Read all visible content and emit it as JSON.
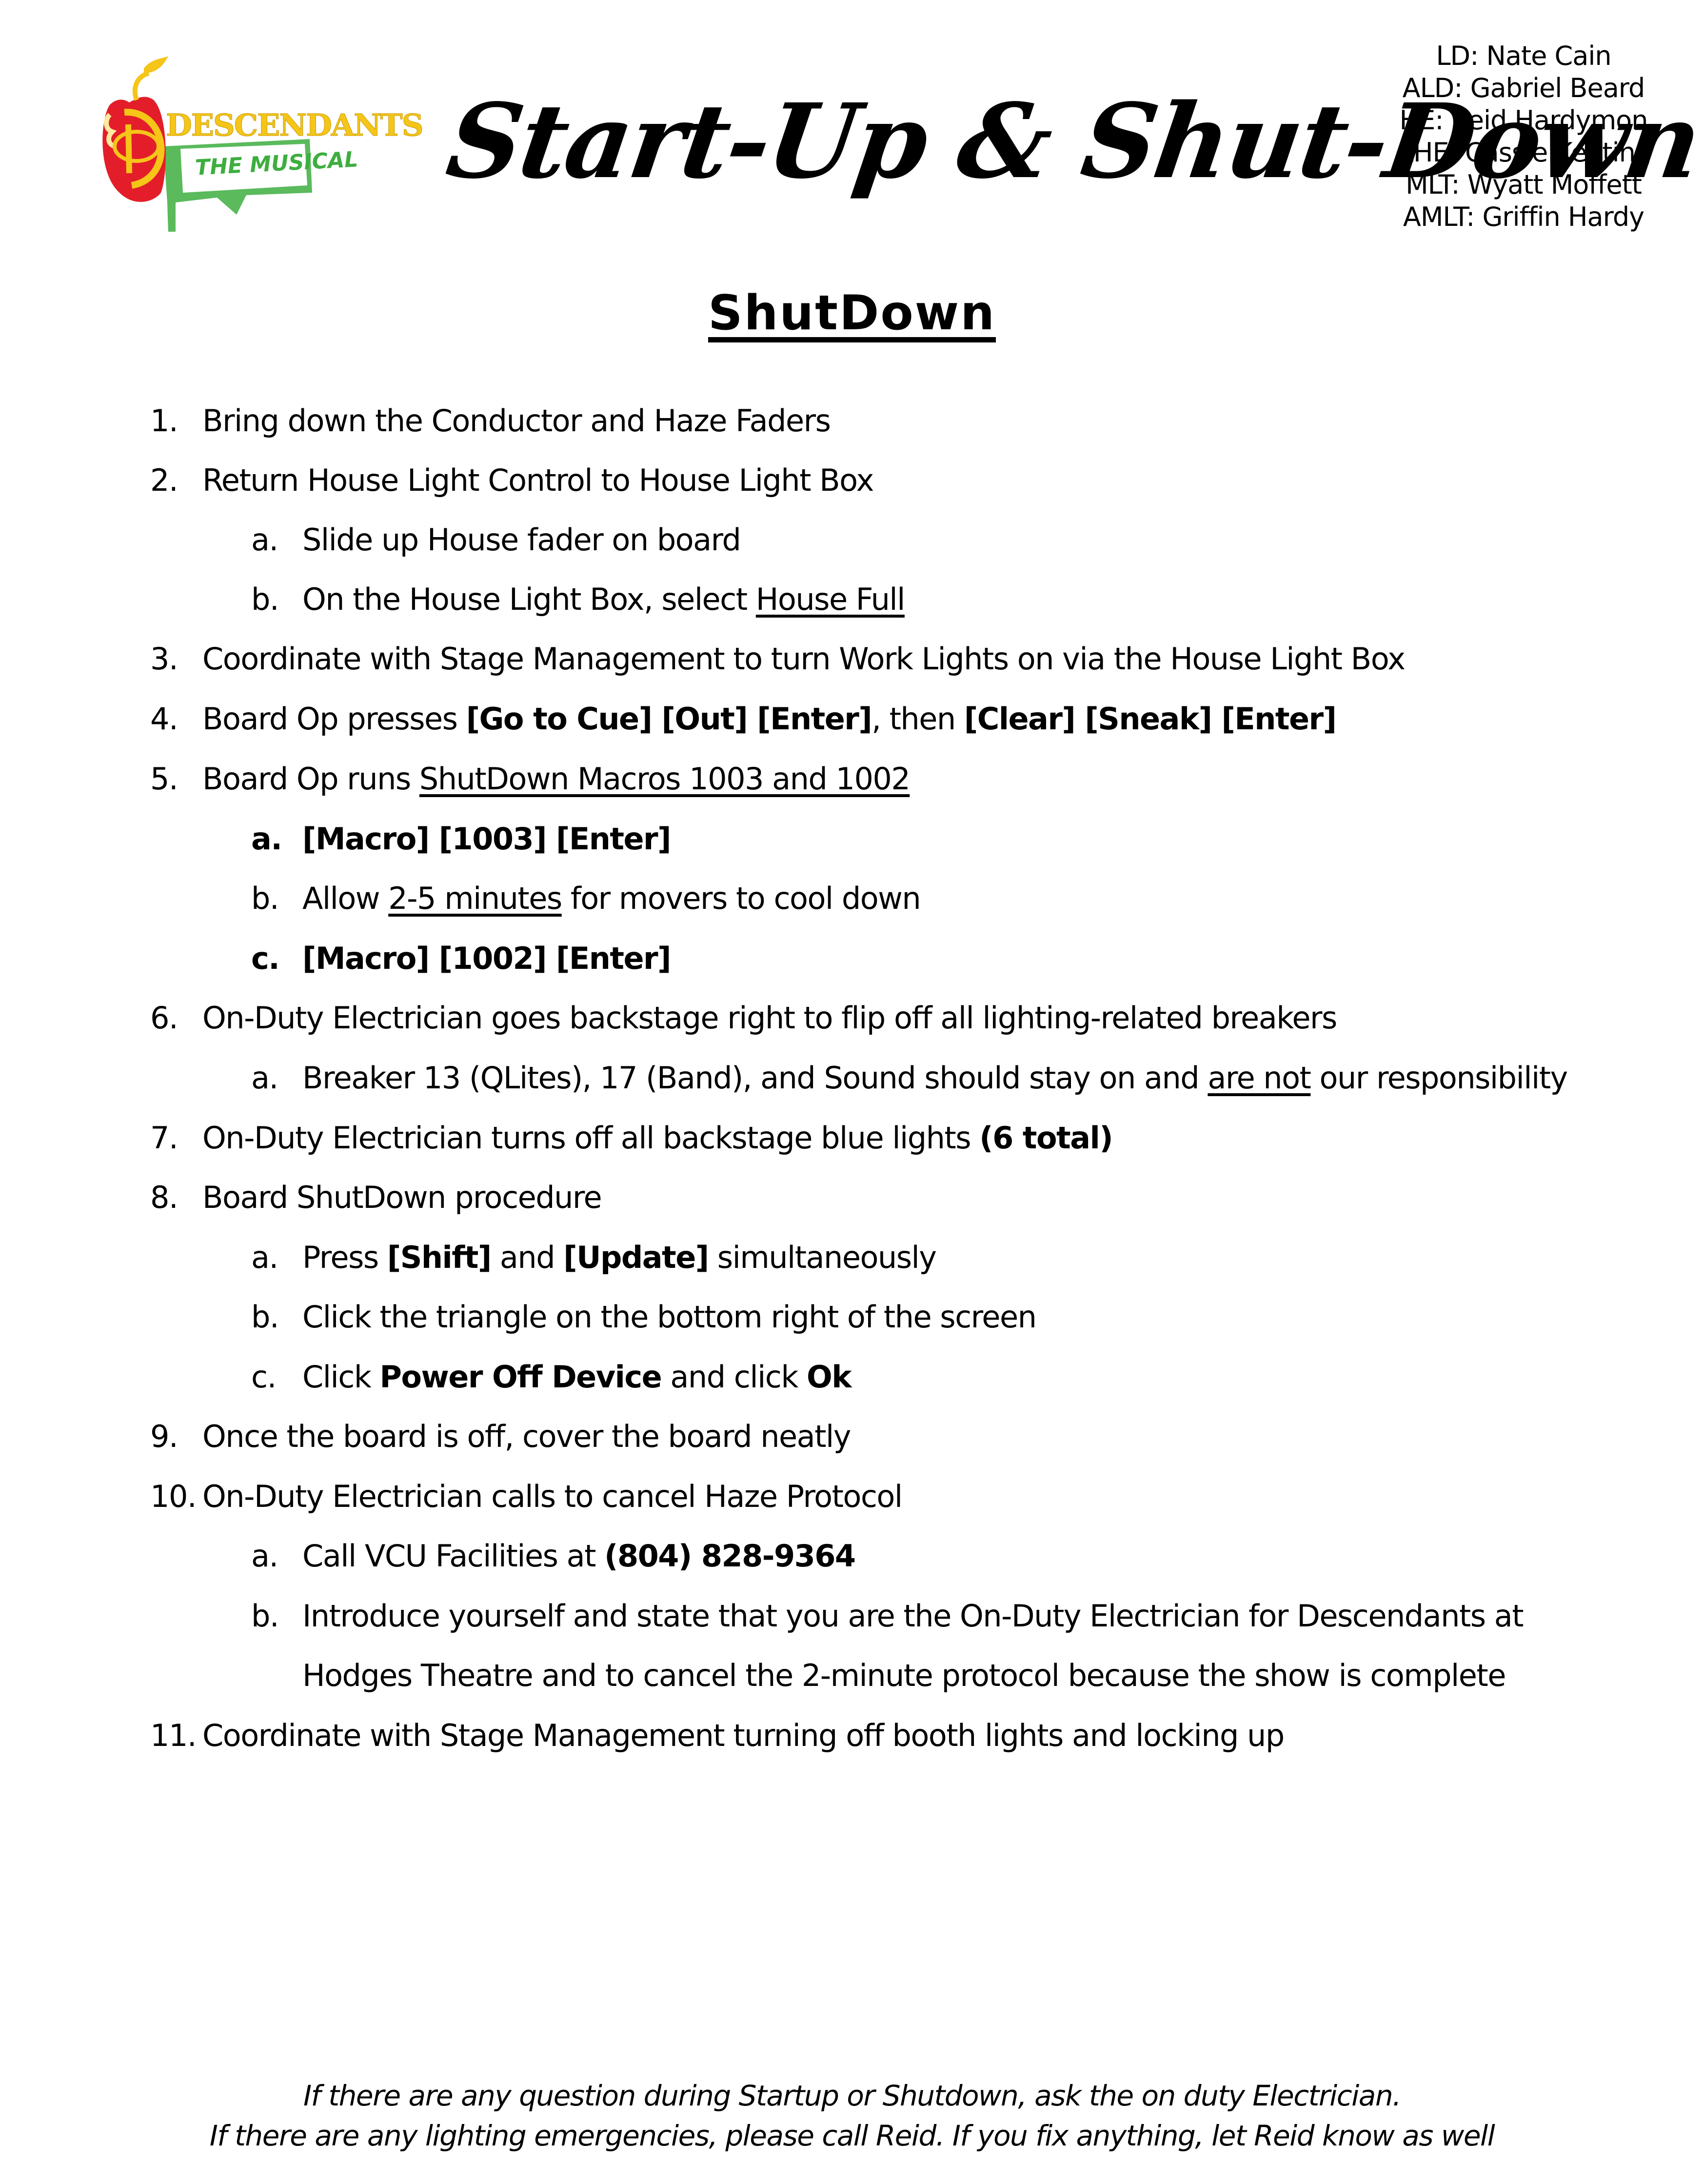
{
  "header": {
    "logo": {
      "name": "descendants-the-musical-logo",
      "wordmark": "DESCENDANTS",
      "tagline": "THE MUSICAL",
      "colors": {
        "apple_red": "#e31e2a",
        "gold": "#f5c518",
        "green": "#3dae3f"
      }
    },
    "title": "Start-Up & Shut-Down",
    "crew": [
      "LD: Nate Cain",
      "ALD: Gabriel Beard",
      "HE: Reid Hardymon",
      "AHE: Cassie Keating",
      "MLT: Wyatt Moffett",
      "AMLT: Griffin Hardy"
    ]
  },
  "section_heading": "ShutDown",
  "steps": [
    {
      "num": "1.",
      "parts": [
        {
          "t": "Bring down the Conductor and Haze Faders"
        }
      ]
    },
    {
      "num": "2.",
      "parts": [
        {
          "t": "Return House Light Control to House Light Box"
        }
      ],
      "subs": [
        {
          "num": "a.",
          "parts": [
            {
              "t": "Slide up House fader on board"
            }
          ]
        },
        {
          "num": "b.",
          "parts": [
            {
              "t": "On the House Light Box, select "
            },
            {
              "t": "House Full",
              "u": true
            }
          ]
        }
      ]
    },
    {
      "num": "3.",
      "parts": [
        {
          "t": "Coordinate with Stage Management to turn Work Lights on via the House Light Box"
        }
      ]
    },
    {
      "num": "4.",
      "parts": [
        {
          "t": "Board Op presses "
        },
        {
          "t": "[Go to Cue] [Out] [Enter]",
          "b": true
        },
        {
          "t": ", then "
        },
        {
          "t": "[Clear] [Sneak] [Enter]",
          "b": true
        }
      ]
    },
    {
      "num": "5.",
      "parts": [
        {
          "t": "Board Op runs "
        },
        {
          "t": "ShutDown Macros 1003 and 1002",
          "u": true
        }
      ],
      "subs": [
        {
          "num": "a.",
          "bold_num": true,
          "parts": [
            {
              "t": "[Macro] [1003] [Enter]",
              "b": true
            }
          ]
        },
        {
          "num": "b.",
          "parts": [
            {
              "t": "Allow "
            },
            {
              "t": "2-5 minutes",
              "u": true
            },
            {
              "t": " for movers to cool down"
            }
          ]
        },
        {
          "num": "c.",
          "bold_num": true,
          "parts": [
            {
              "t": "[Macro] [1002] [Enter]",
              "b": true
            }
          ]
        }
      ]
    },
    {
      "num": "6.",
      "parts": [
        {
          "t": "On-Duty Electrician goes backstage right to flip off all lighting-related breakers"
        }
      ],
      "subs": [
        {
          "num": "a.",
          "parts": [
            {
              "t": "Breaker 13 (QLites), 17 (Band), and Sound should stay on and "
            },
            {
              "t": "are not",
              "u": true
            },
            {
              "t": " our responsibility"
            }
          ]
        }
      ]
    },
    {
      "num": "7.",
      "parts": [
        {
          "t": "On-Duty Electrician turns off all backstage blue lights "
        },
        {
          "t": "(6 total)",
          "b": true
        }
      ]
    },
    {
      "num": "8.",
      "parts": [
        {
          "t": "Board ShutDown procedure"
        }
      ],
      "subs": [
        {
          "num": "a.",
          "parts": [
            {
              "t": "Press "
            },
            {
              "t": "[Shift]",
              "b": true
            },
            {
              "t": " and "
            },
            {
              "t": "[Update]",
              "b": true
            },
            {
              "t": " simultaneously"
            }
          ]
        },
        {
          "num": "b.",
          "parts": [
            {
              "t": "Click the triangle on the bottom right of the screen"
            }
          ]
        },
        {
          "num": "c.",
          "parts": [
            {
              "t": "Click "
            },
            {
              "t": "Power Off Device",
              "b": true
            },
            {
              "t": " and click "
            },
            {
              "t": "Ok",
              "b": true
            }
          ]
        }
      ]
    },
    {
      "num": "9.",
      "parts": [
        {
          "t": "Once the board is off, cover the board neatly"
        }
      ]
    },
    {
      "num": "10.",
      "parts": [
        {
          "t": "On-Duty Electrician calls to cancel Haze Protocol"
        }
      ],
      "subs": [
        {
          "num": "a.",
          "parts": [
            {
              "t": "Call VCU Facilities at "
            },
            {
              "t": "(804) 828-9364",
              "b": true
            }
          ]
        },
        {
          "num": "b.",
          "parts": [
            {
              "t": "Introduce yourself and state that you are the On-Duty Electrician for Descendants at"
            }
          ],
          "continuation": "Hodges Theatre and to cancel the 2-minute protocol because the show is complete"
        }
      ]
    },
    {
      "num": "11.",
      "parts": [
        {
          "t": "Coordinate with Stage Management turning off booth lights and locking up"
        }
      ]
    }
  ],
  "footer": [
    "If there are any question during Startup or Shutdown, ask the on duty Electrician.",
    "If there are any lighting emergencies, please call Reid. If you fix anything, let Reid know as well"
  ]
}
